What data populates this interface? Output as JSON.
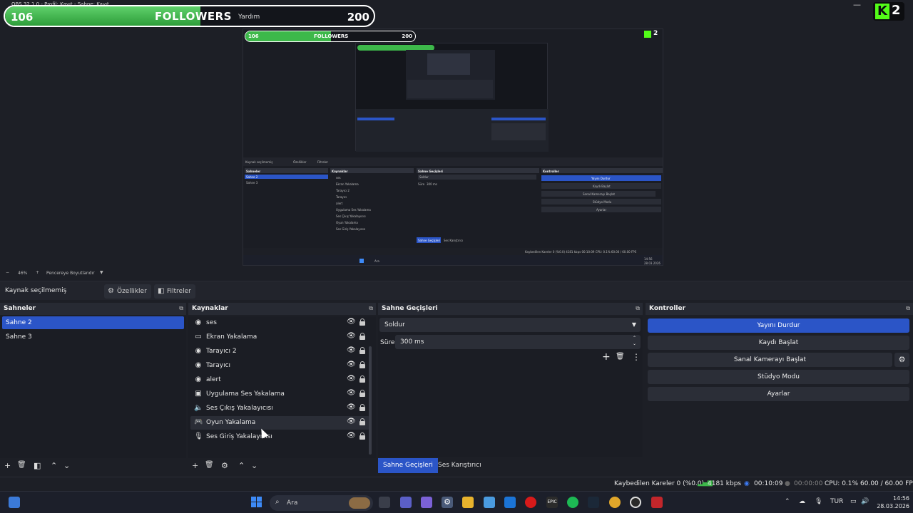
{
  "window": {
    "title_partial": "OBS 32.1.0 - Profil: Kayıt - Sahne: Kayıt",
    "minimize_glyph": "—"
  },
  "overlay": {
    "follower_current": "106",
    "follower_goal": "200",
    "follower_title": "FOLLOWERS",
    "follower_help": "Yardım",
    "progress_fraction": 0.53,
    "kick_letter": "K",
    "kick_count": "2",
    "kick_color": "#53fc18",
    "bar_fill_color": "#3db84a"
  },
  "nested_preview": {
    "followers": "FOLLOWERS",
    "cur": "106",
    "goal": "200",
    "kick_count": "2",
    "source_label": "Kaynak seçilmemiş",
    "props": "Özellikler",
    "filters": "Filtreler",
    "scenes_hdr": "Sahneler",
    "sources_hdr": "Kaynaklar",
    "trans_hdr": "Sahne Geçişleri",
    "ctrl_hdr": "Kontroller",
    "scenes": [
      "Sahne 2",
      "Sahne 3"
    ],
    "sources": [
      "ses",
      "Ekran Yakalama",
      "Tarayıcı 2",
      "Tarayıcı",
      "alert",
      "Uygulama Ses Yakalama",
      "Ses Çıkış Yakalayıcısı",
      "Oyun Yakalama",
      "Ses Giriş Yakalayıcısı"
    ],
    "trans_select": "Soldur",
    "duration_label": "Süre",
    "duration_value": "300 ms",
    "controls": [
      "Yayını Durdur",
      "Kaydı Başlat",
      "Sanal Kamerayı Başlat",
      "Stüdyo Modu",
      "Ayarlar"
    ],
    "tab_active": "Sahne Geçişleri",
    "tab_other": "Ses Karıştırıcı",
    "status": "Kaybedilen Kareler 0 (%0.0)   4181 kbps   00:10:09   CPU: 0.1%   60.00 / 60.00 FPS",
    "search": "Ara",
    "time": "14:56",
    "date": "28.03.2026"
  },
  "zoom": {
    "minus": "−",
    "value": "46%",
    "plus": "+",
    "fit_label": "Pencereye Boyutlandır",
    "arrow": "▼"
  },
  "source_toolbar": {
    "label": "Kaynak seçilmemiş",
    "properties": "Özellikler",
    "filters": "Filtreler"
  },
  "scenes": {
    "header": "Sahneler",
    "items": [
      {
        "label": "Sahne 2",
        "selected": true
      },
      {
        "label": "Sahne 3",
        "selected": false
      }
    ]
  },
  "sources": {
    "header": "Kaynaklar",
    "items": [
      {
        "label": "ses",
        "icon": "browser-icon",
        "glyph": "◉"
      },
      {
        "label": "Ekran Yakalama",
        "icon": "monitor-icon",
        "glyph": "▭"
      },
      {
        "label": "Tarayıcı 2",
        "icon": "browser-icon",
        "glyph": "◉"
      },
      {
        "label": "Tarayıcı",
        "icon": "browser-icon",
        "glyph": "◉"
      },
      {
        "label": "alert",
        "icon": "browser-icon",
        "glyph": "◉"
      },
      {
        "label": "Uygulama Ses Yakalama",
        "icon": "app-audio-icon",
        "glyph": "▣"
      },
      {
        "label": "Ses Çıkış Yakalayıcısı",
        "icon": "speaker-icon",
        "glyph": "🔈"
      },
      {
        "label": "Oyun Yakalama",
        "icon": "gamepad-icon",
        "glyph": "🎮"
      },
      {
        "label": "Ses Giriş Yakalayıcısı",
        "icon": "microphone-icon",
        "glyph": "🎙"
      }
    ],
    "eye_glyph": "👁",
    "hover_index": 7
  },
  "transitions": {
    "header": "Sahne Geçişleri",
    "selected": "Soldur",
    "duration_label": "Süre",
    "duration_value": "300 ms",
    "add": "+",
    "delete": "🗑",
    "more": "⋮",
    "tabs": [
      "Sahne Geçişleri",
      "Ses Karıştırıcı"
    ]
  },
  "controls": {
    "header": "Kontroller",
    "buttons": [
      "Yayını Durdur",
      "Kaydı Başlat",
      "Sanal Kamerayı Başlat",
      "Stüdyo Modu",
      "Ayarlar"
    ],
    "gear": "⚙",
    "primary_color": "#2b55c7"
  },
  "dock_icons": {
    "undock": "⧉",
    "add": "+",
    "trash": "🗑",
    "filter": "◧",
    "up": "⌃",
    "down": "⌄",
    "settings": "⚙"
  },
  "statusbar": {
    "dropped": "Kaybedilen Kareler 0 (%0.0)",
    "bitrate": "4181 kbps",
    "stream_time": "00:10:09",
    "rec_time": "00:00:00",
    "cpu": "CPU: 0.1%",
    "fps": "60.00 / 60.00 FPS"
  },
  "taskbar": {
    "search": "Ara",
    "lang": "TUR",
    "time": "14:56",
    "date": "28.03.2026",
    "up_arrow": "⌃"
  }
}
